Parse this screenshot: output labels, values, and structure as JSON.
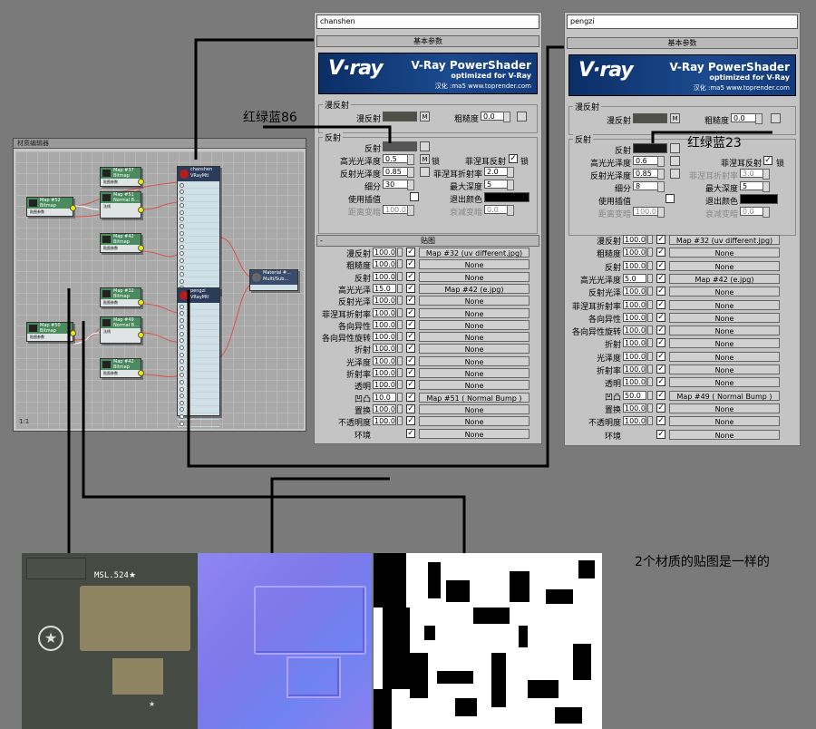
{
  "slate": {
    "title": "材质编辑器",
    "nodes": [
      {
        "name": "Map #37",
        "type": "Bitmap",
        "sub": "贴图参数"
      },
      {
        "name": "Map #51",
        "type": "Normal B...",
        "sub": "法线"
      },
      {
        "name": "Map #52",
        "type": "Bitmap",
        "sub": "贴图参数"
      },
      {
        "name": "Map #42",
        "type": "Bitmap",
        "sub": "贴图参数"
      },
      {
        "name": "Map #32",
        "type": "Bitmap",
        "sub": "贴图参数"
      },
      {
        "name": "Map #49",
        "type": "Normal B...",
        "sub": "法线"
      },
      {
        "name": "Map #50",
        "type": "Bitmap",
        "sub": "贴图参数"
      },
      {
        "name": "Map #42",
        "type": "Bitmap",
        "sub": "贴图参数"
      }
    ],
    "vray1": {
      "name": "chanshen",
      "type": "VRayMtl"
    },
    "vray2": {
      "name": "pengzi",
      "type": "VRayMtl"
    },
    "multi": {
      "name": "Material #...",
      "type": "Multi/Sub..."
    },
    "zoom": "1:1"
  },
  "panel1": {
    "name": "chanshen",
    "rollout_basic": "基本参数",
    "banner": {
      "logo": "V·ray",
      "title": "V-Ray PowerShader",
      "sub": "optimized for V-Ray",
      "author": "汉化 :ma5 www.toprender.com"
    },
    "diffuse_group": "漫反射",
    "diffuse_label": "漫反射",
    "roughness_label": "粗糙度",
    "roughness_value": "0.0",
    "reflect_group": "反射",
    "reflect_label": "反射",
    "hilight_label": "高光光泽度",
    "hilight_value": "0.5",
    "lock_label": "锁",
    "fresnel_label": "菲涅耳反射",
    "refl_gloss_label": "反射光泽度",
    "refl_gloss_value": "0.85",
    "fresnel_ior_label": "菲涅耳折射率",
    "fresnel_ior_value": "2.0",
    "subdivs_label": "细分",
    "subdivs_value": "30",
    "maxdepth_label": "最大深度",
    "maxdepth_value": "5",
    "interp_label": "使用插值",
    "exitcolor_label": "退出颜色",
    "dimdist_label": "距离变暗",
    "dimdist_value": "100.0",
    "dimfall_label": "衰减变暗",
    "dimfall_value": "0.0",
    "maps_rollout": "贴图",
    "maps_minus": "-",
    "maps": [
      {
        "label": "漫反射",
        "value": "100.0",
        "map": "Map #32 (uv different.jpg)"
      },
      {
        "label": "粗糙度",
        "value": "100.0",
        "map": "None"
      },
      {
        "label": "反射",
        "value": "100.0",
        "map": "None"
      },
      {
        "label": "高光光泽",
        "value": "15.0",
        "map": "Map #42 (e.jpg)"
      },
      {
        "label": "反射光泽",
        "value": "100.0",
        "map": "None"
      },
      {
        "label": "菲涅耳折射率",
        "value": "100.0",
        "map": "None"
      },
      {
        "label": "各向异性",
        "value": "100.0",
        "map": "None"
      },
      {
        "label": "各向异性旋转",
        "value": "100.0",
        "map": "None"
      },
      {
        "label": "折射",
        "value": "100.0",
        "map": "None"
      },
      {
        "label": "光泽度",
        "value": "100.0",
        "map": "None"
      },
      {
        "label": "折射率",
        "value": "100.0",
        "map": "None"
      },
      {
        "label": "透明",
        "value": "100.0",
        "map": "None"
      },
      {
        "label": "凹凸",
        "value": "10.0",
        "map": "Map #51 ( Normal Bump )"
      },
      {
        "label": "置换",
        "value": "100.0",
        "map": "None"
      },
      {
        "label": "不透明度",
        "value": "100.0",
        "map": "None"
      },
      {
        "label": "环境",
        "value": "",
        "map": "None"
      }
    ]
  },
  "panel2": {
    "name": "pengzi",
    "rollout_basic": "基本参数",
    "banner": {
      "logo": "V·ray",
      "title": "V-Ray PowerShader",
      "sub": "optimized for V-Ray",
      "author": "汉化 :ma5 www.toprender.com"
    },
    "diffuse_group": "漫反射",
    "diffuse_label": "漫反射",
    "roughness_label": "粗糙度",
    "roughness_value": "0.0",
    "reflect_group": "反射",
    "reflect_label": "反射",
    "hilight_label": "高光光泽度",
    "hilight_value": "0.6",
    "lock_label": "锁",
    "fresnel_label": "菲涅耳反射",
    "refl_gloss_label": "反射光泽度",
    "refl_gloss_value": "0.85",
    "fresnel_ior_label": "菲涅耳折射率",
    "fresnel_ior_value": "3.0",
    "subdivs_label": "细分",
    "subdivs_value": "8",
    "maxdepth_label": "最大深度",
    "maxdepth_value": "5",
    "interp_label": "使用插值",
    "exitcolor_label": "退出颜色",
    "dimdist_label": "距离变暗",
    "dimdist_value": "100.0",
    "dimfall_label": "衰减变暗",
    "dimfall_value": "0.0",
    "maps": [
      {
        "label": "漫反射",
        "value": "100.0",
        "map": "Map #32 (uv different.jpg)"
      },
      {
        "label": "粗糙度",
        "value": "100.0",
        "map": "None"
      },
      {
        "label": "反射",
        "value": "100.0",
        "map": "None"
      },
      {
        "label": "高光光泽度",
        "value": "5.0",
        "map": "Map #42 (e.jpg)"
      },
      {
        "label": "反射光泽",
        "value": "100.0",
        "map": "None"
      },
      {
        "label": "菲涅耳折射率",
        "value": "100.0",
        "map": "None"
      },
      {
        "label": "各向异性",
        "value": "100.0",
        "map": "None"
      },
      {
        "label": "各向异性旋转",
        "value": "100.0",
        "map": "None"
      },
      {
        "label": "折射",
        "value": "100.0",
        "map": "None"
      },
      {
        "label": "光泽度",
        "value": "100.0",
        "map": "None"
      },
      {
        "label": "折射率",
        "value": "100.0",
        "map": "None"
      },
      {
        "label": "透明",
        "value": "100.0",
        "map": "None"
      },
      {
        "label": "凹凸",
        "value": "50.0",
        "map": "Map #49 ( Normal Bump )"
      },
      {
        "label": "置换",
        "value": "100.0",
        "map": "None"
      },
      {
        "label": "不透明度",
        "value": "100.0",
        "map": "None"
      },
      {
        "label": "环境",
        "value": "",
        "map": "None"
      }
    ]
  },
  "annotations": {
    "rgb86": "红绿蓝86",
    "rgb23": "红绿蓝23",
    "same_maps": "2个材质的贴图是一样的"
  },
  "textures": {
    "diffuse_label": "MSL.524",
    "star_text": "★"
  },
  "colors": {
    "background": "#7a7a7a",
    "panel": "#c4c4c4",
    "reflect1": "#565656",
    "reflect2": "#171717",
    "diffuse_swatch": "#4f5048",
    "banner": "#1c4a8e"
  }
}
